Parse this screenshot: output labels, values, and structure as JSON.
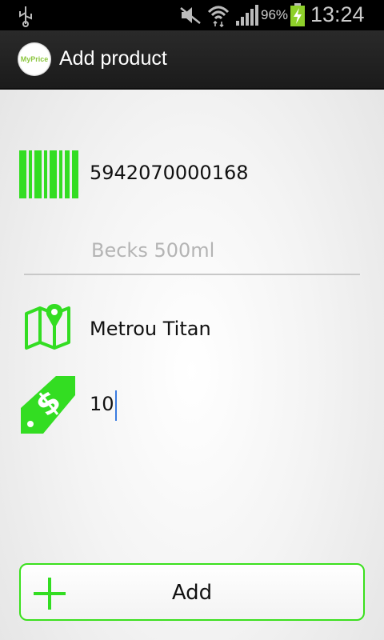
{
  "status_bar": {
    "battery_percent": "96%",
    "time": "13:24",
    "icons": [
      "usb-icon",
      "mute-icon",
      "wifi-icon",
      "signal-icon",
      "battery-charging-icon"
    ]
  },
  "action_bar": {
    "logo_text": "MyPrice",
    "title": "Add product"
  },
  "form": {
    "barcode": {
      "value": "5942070000168",
      "icon": "barcode-icon"
    },
    "name": {
      "value": "",
      "placeholder": "Becks 500ml"
    },
    "location": {
      "value": "Metrou Titan",
      "icon": "map-pin-icon"
    },
    "price": {
      "value": "10",
      "icon": "price-tag-icon"
    }
  },
  "add_button": {
    "label": "Add",
    "icon": "plus-icon"
  },
  "colors": {
    "accent": "#33dd22",
    "action_bar": "#222222",
    "status_bar": "#000000"
  }
}
